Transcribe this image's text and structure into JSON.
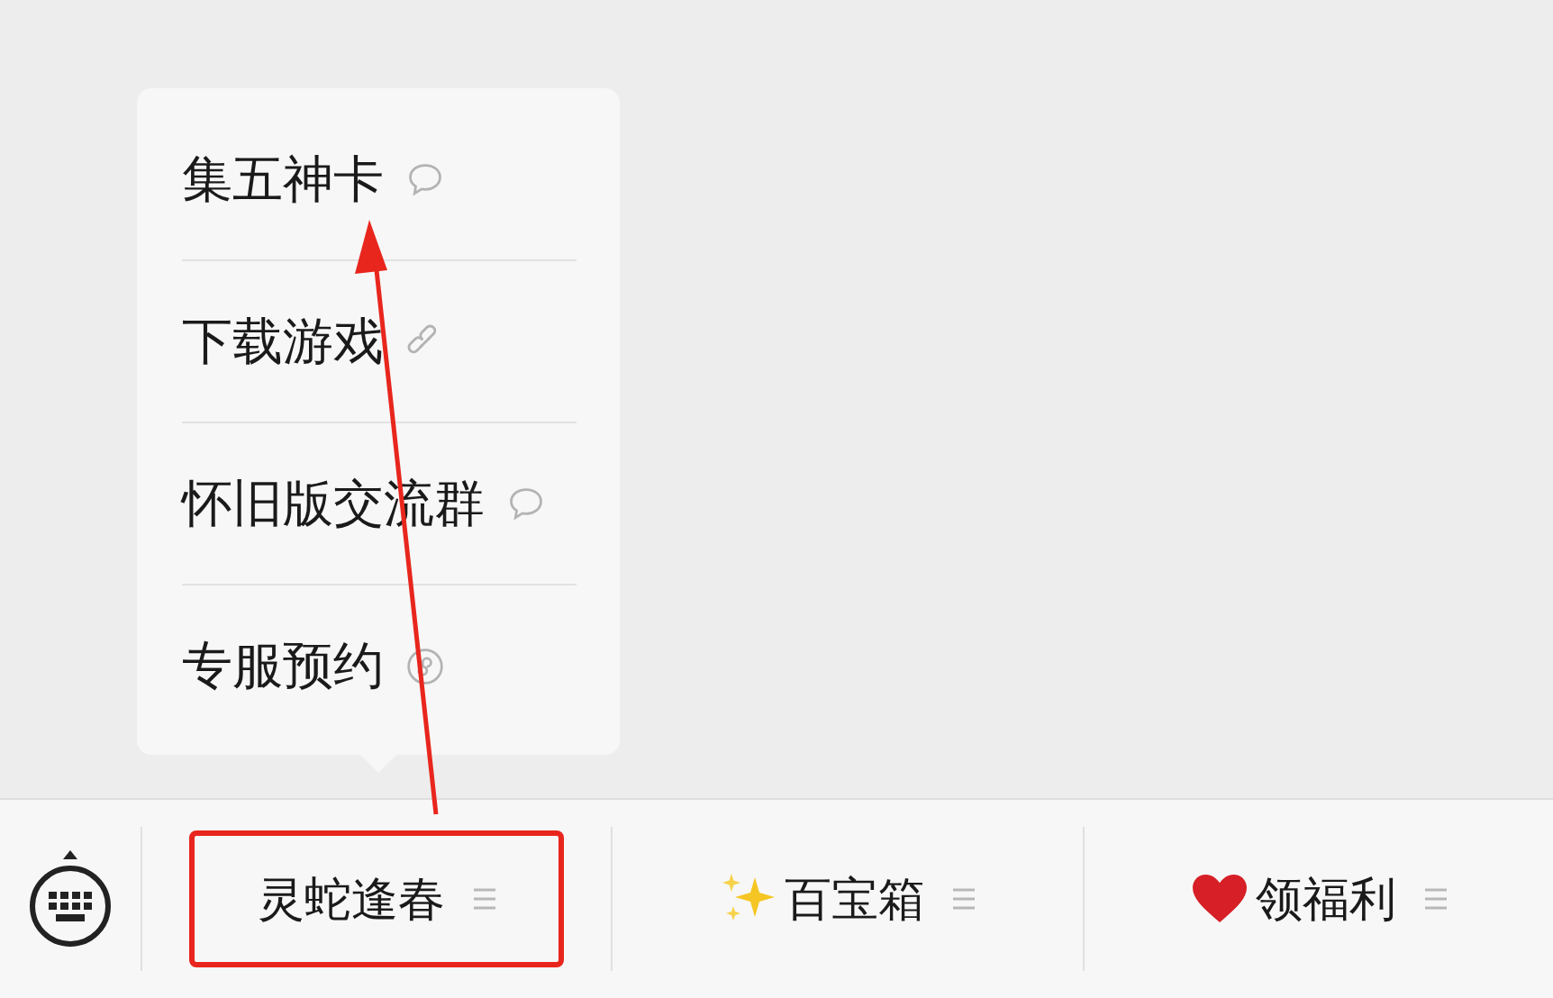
{
  "popup_menu": {
    "items": [
      {
        "label": "集五神卡",
        "kind": "message"
      },
      {
        "label": "下载游戏",
        "kind": "link"
      },
      {
        "label": "怀旧版交流群",
        "kind": "message"
      },
      {
        "label": "专服预约",
        "kind": "miniprogram"
      }
    ]
  },
  "menu_bar": {
    "tabs": [
      {
        "label": "灵蛇逢春",
        "kind": "plain",
        "selected": true
      },
      {
        "label": "百宝箱",
        "kind": "sparkles",
        "selected": false
      },
      {
        "label": "领福利",
        "kind": "heart",
        "selected": false
      }
    ]
  }
}
